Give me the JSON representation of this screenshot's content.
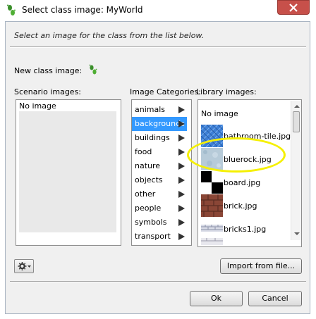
{
  "window": {
    "title": "Select class image: MyWorld",
    "icon": "greenfoot-footprint-icon"
  },
  "instructions": "Select an image for the class from the list below.",
  "new_class": {
    "label": "New class image:",
    "icon": "greenfoot-footprint-icon"
  },
  "scenario": {
    "label": "Scenario images:",
    "items": [
      "No image"
    ]
  },
  "categories": {
    "label": "Image Categories:",
    "items": [
      "animals",
      "backgrounds",
      "buildings",
      "food",
      "nature",
      "objects",
      "other",
      "people",
      "symbols",
      "transport"
    ],
    "selected": "backgrounds"
  },
  "library": {
    "label": "Library images:",
    "none_label": "No image",
    "items": [
      "bathroom-tile.jpg",
      "bluerock.jpg",
      "board.jpg",
      "brick.jpg",
      "bricks1.jpg"
    ]
  },
  "buttons": {
    "import": "Import from file...",
    "ok": "Ok",
    "cancel": "Cancel"
  },
  "colors": {
    "selection": "#3399ff",
    "close_button": "#c7504a",
    "annotation": "#f5f000"
  }
}
